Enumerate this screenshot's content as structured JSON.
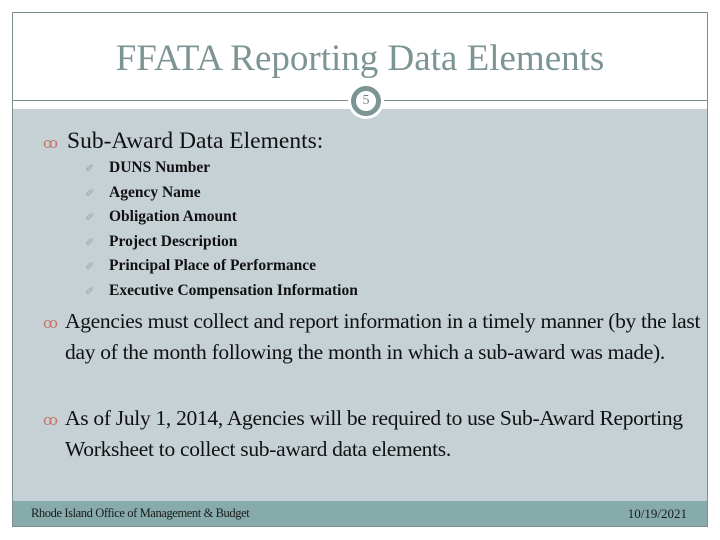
{
  "slide": {
    "title": "FFATA Reporting Data Elements",
    "page_number": "5",
    "bullet_symbol": "ꝏ",
    "sub_bullet_symbol": "✐",
    "section_heading": "Sub-Award Data Elements:",
    "sub_items": [
      "DUNS Number",
      "Agency Name",
      "Obligation Amount",
      "Project Description",
      "Principal Place of Performance",
      "Executive Compensation Information"
    ],
    "paragraphs": [
      "Agencies must collect and report information in a timely manner (by the last day of the month following the month in which a sub-award was made).",
      "As of July 1, 2014, Agencies will be required to use Sub-Award Reporting Worksheet to collect sub-award data elements."
    ]
  },
  "footer": {
    "organization": "Rhode Island Office of Management & Budget",
    "date": "10/19/2021"
  },
  "colors": {
    "title": "#7d9494",
    "panel": "#c6d1d6",
    "footer": "#87abab",
    "bullet": "#c87165"
  }
}
